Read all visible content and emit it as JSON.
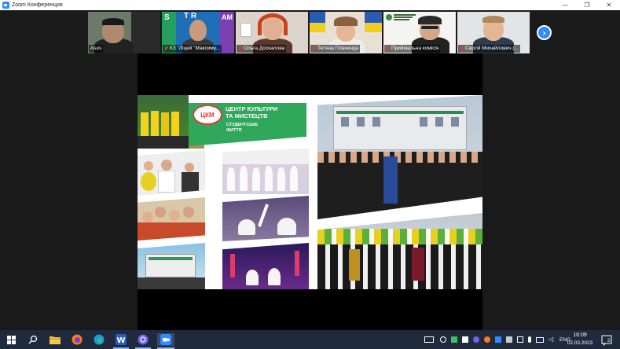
{
  "window": {
    "title": "Zoom Конференция",
    "controls": [
      "—",
      "❐",
      "✕"
    ]
  },
  "participants": [
    {
      "name": "Asus",
      "muted": false
    },
    {
      "name": "КЗ \"Ліцей \"Максиму...",
      "muted": true
    },
    {
      "name": "Ольга Доскалова",
      "muted": true
    },
    {
      "name": "Тетяна Плачинда",
      "muted": true
    },
    {
      "name": "Приймальна комісія",
      "muted": true
    },
    {
      "name": "Сергій Михайлович (...",
      "muted": true
    }
  ],
  "strip_next": "›",
  "slide": {
    "logo_text": "ЦКМ",
    "title_line1": "ЦЕНТР КУЛЬТУРИ",
    "title_line2": "ТА МИСТЕЦТВ",
    "subtitle_line1": "СТУДЕНТСЬКЕ",
    "subtitle_line2": "ЖИТТЯ"
  },
  "taskbar": {
    "language": "ENG",
    "time": "16:09",
    "date": "02.03.2023",
    "notifications": "2"
  },
  "colors": {
    "zoom_blue": "#2d8cff",
    "taskbar": "#1f2a3c",
    "banner_green": "#2fa85c",
    "muted_red": "#e53935"
  }
}
